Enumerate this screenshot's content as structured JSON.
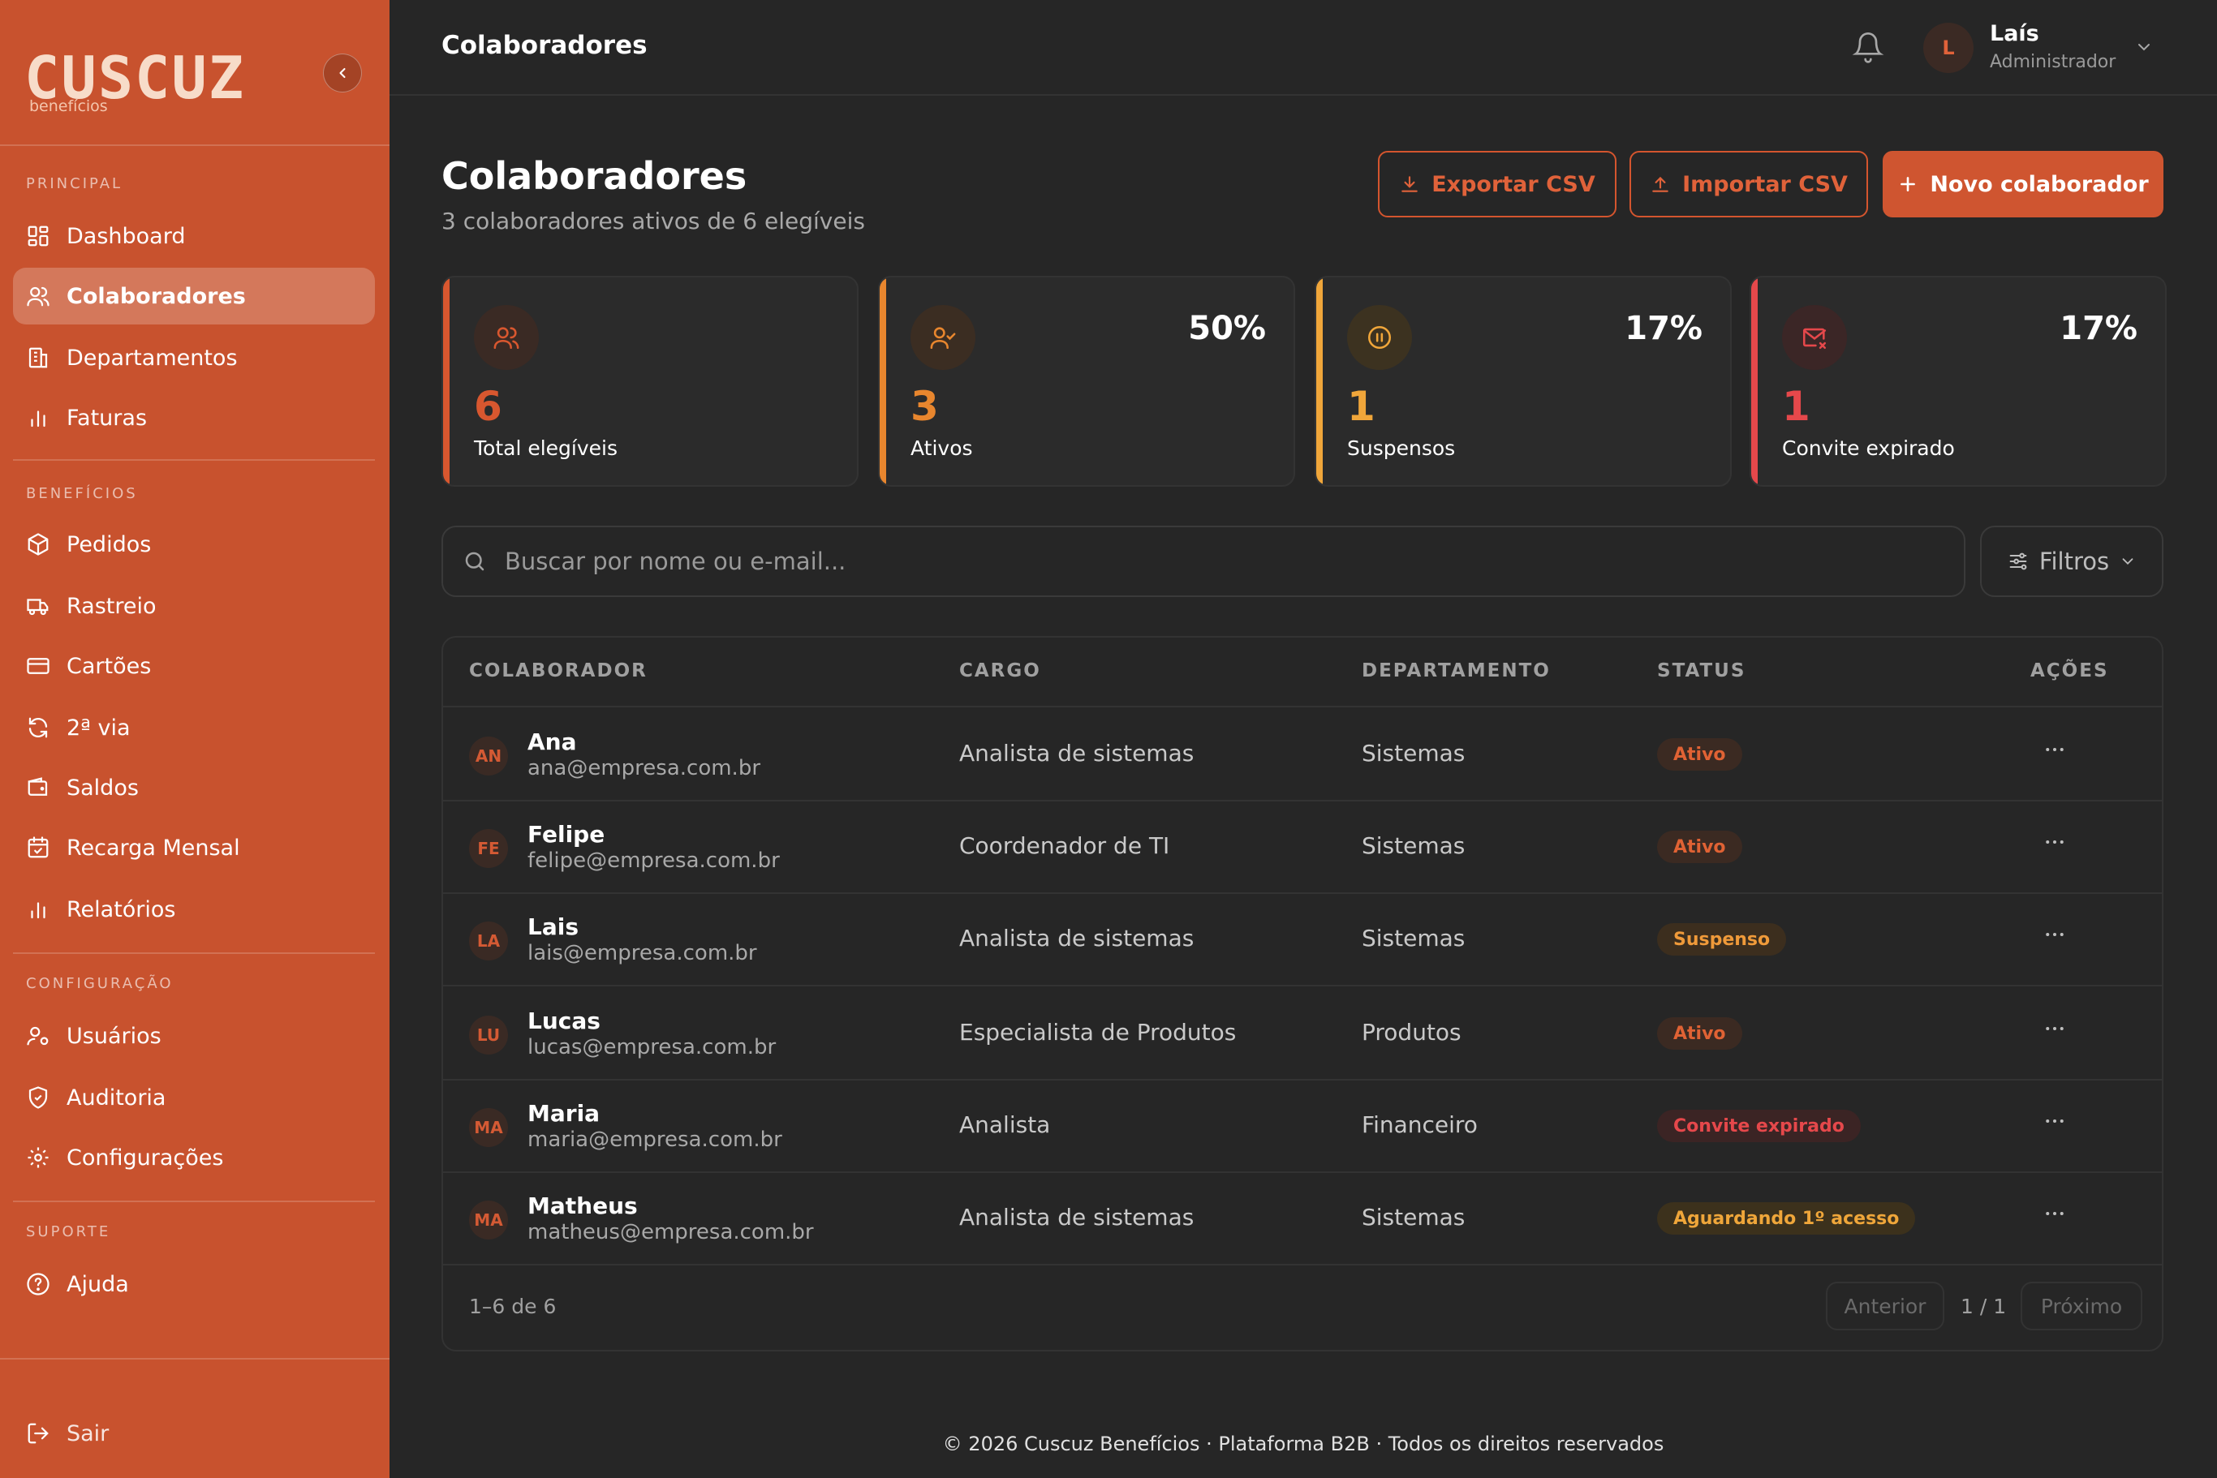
{
  "brand": {
    "logo_word": "CUSCUZ",
    "logo_sub": "benefícios",
    "accent": "#cf5530"
  },
  "sidebar": {
    "sections": [
      {
        "label": "PRINCIPAL"
      },
      {
        "label": "BENEFÍCIOS"
      },
      {
        "label": "CONFIGURAÇÃO"
      },
      {
        "label": "SUPORTE"
      }
    ],
    "items": [
      {
        "label": "Dashboard",
        "icon": "grid-icon"
      },
      {
        "label": "Colaboradores",
        "icon": "users-icon",
        "active": true
      },
      {
        "label": "Departamentos",
        "icon": "building-icon"
      },
      {
        "label": "Faturas",
        "icon": "bar-chart-icon"
      },
      {
        "label": "Pedidos",
        "icon": "package-icon"
      },
      {
        "label": "Rastreio",
        "icon": "truck-icon"
      },
      {
        "label": "Cartões",
        "icon": "card-icon"
      },
      {
        "label": "2ª via",
        "icon": "refresh-icon"
      },
      {
        "label": "Saldos",
        "icon": "wallet-icon"
      },
      {
        "label": "Recarga Mensal",
        "icon": "calendar-check-icon"
      },
      {
        "label": "Relatórios",
        "icon": "bar-chart-icon"
      },
      {
        "label": "Usuários",
        "icon": "user-gear-icon"
      },
      {
        "label": "Auditoria",
        "icon": "shield-check-icon"
      },
      {
        "label": "Configurações",
        "icon": "gear-icon"
      },
      {
        "label": "Ajuda",
        "icon": "help-circle-icon"
      }
    ],
    "logout": "Sair"
  },
  "topbar": {
    "title": "Colaboradores",
    "user": {
      "initial": "L",
      "name": "Laís",
      "role": "Administrador"
    }
  },
  "page": {
    "title": "Colaboradores",
    "subtitle": "3 colaboradores ativos de 6 elegíveis",
    "buttons": {
      "export": "Exportar CSV",
      "import": "Importar CSV",
      "new": "Novo colaborador"
    }
  },
  "stats": [
    {
      "value": "6",
      "label": "Total elegíveis",
      "pct": "",
      "color": "#d8572f",
      "icon": "users-icon"
    },
    {
      "value": "3",
      "label": "Ativos",
      "pct": "50%",
      "color": "#e8862e",
      "icon": "user-check-icon"
    },
    {
      "value": "1",
      "label": "Suspensos",
      "pct": "17%",
      "color": "#f0a63a",
      "icon": "pause-circle-icon"
    },
    {
      "value": "1",
      "label": "Convite expirado",
      "pct": "17%",
      "color": "#e5484b",
      "icon": "mail-x-icon"
    }
  ],
  "search": {
    "placeholder": "Buscar por nome ou e-mail...",
    "filters": "Filtros"
  },
  "table": {
    "headers": [
      "COLABORADOR",
      "CARGO",
      "DEPARTAMENTO",
      "STATUS",
      "AÇÕES"
    ],
    "rows": [
      {
        "initials": "AN",
        "name": "Ana",
        "email": "ana@empresa.com.br",
        "cargo": "Analista de sistemas",
        "dept": "Sistemas",
        "status": "Ativo",
        "status_kind": "ativo"
      },
      {
        "initials": "FE",
        "name": "Felipe",
        "email": "felipe@empresa.com.br",
        "cargo": "Coordenador de TI",
        "dept": "Sistemas",
        "status": "Ativo",
        "status_kind": "ativo"
      },
      {
        "initials": "LA",
        "name": "Lais",
        "email": "lais@empresa.com.br",
        "cargo": "Analista de sistemas",
        "dept": "Sistemas",
        "status": "Suspenso",
        "status_kind": "suspenso"
      },
      {
        "initials": "LU",
        "name": "Lucas",
        "email": "lucas@empresa.com.br",
        "cargo": "Especialista de Produtos",
        "dept": "Produtos",
        "status": "Ativo",
        "status_kind": "ativo"
      },
      {
        "initials": "MA",
        "name": "Maria",
        "email": "maria@empresa.com.br",
        "cargo": "Analista",
        "dept": "Financeiro",
        "status": "Convite expirado",
        "status_kind": "expirado"
      },
      {
        "initials": "MA",
        "name": "Matheus",
        "email": "matheus@empresa.com.br",
        "cargo": "Analista de sistemas",
        "dept": "Sistemas",
        "status": "Aguardando 1º acesso",
        "status_kind": "aguardando"
      }
    ],
    "footer": {
      "count": "1–6 de 6",
      "prev": "Anterior",
      "page": "1 / 1",
      "next": "Próximo"
    }
  },
  "footer": "© 2026 Cuscuz Benefícios · Plataforma B2B · Todos os direitos reservados"
}
